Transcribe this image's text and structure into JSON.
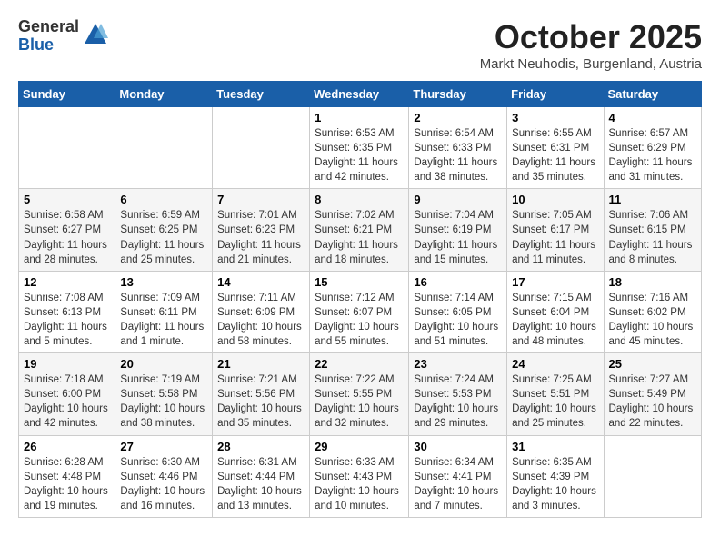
{
  "header": {
    "logo": {
      "general": "General",
      "blue": "Blue"
    },
    "title": "October 2025",
    "location": "Markt Neuhodis, Burgenland, Austria"
  },
  "weekdays": [
    "Sunday",
    "Monday",
    "Tuesday",
    "Wednesday",
    "Thursday",
    "Friday",
    "Saturday"
  ],
  "weeks": [
    [
      {
        "day": "",
        "info": ""
      },
      {
        "day": "",
        "info": ""
      },
      {
        "day": "",
        "info": ""
      },
      {
        "day": "1",
        "info": "Sunrise: 6:53 AM\nSunset: 6:35 PM\nDaylight: 11 hours\nand 42 minutes."
      },
      {
        "day": "2",
        "info": "Sunrise: 6:54 AM\nSunset: 6:33 PM\nDaylight: 11 hours\nand 38 minutes."
      },
      {
        "day": "3",
        "info": "Sunrise: 6:55 AM\nSunset: 6:31 PM\nDaylight: 11 hours\nand 35 minutes."
      },
      {
        "day": "4",
        "info": "Sunrise: 6:57 AM\nSunset: 6:29 PM\nDaylight: 11 hours\nand 31 minutes."
      }
    ],
    [
      {
        "day": "5",
        "info": "Sunrise: 6:58 AM\nSunset: 6:27 PM\nDaylight: 11 hours\nand 28 minutes."
      },
      {
        "day": "6",
        "info": "Sunrise: 6:59 AM\nSunset: 6:25 PM\nDaylight: 11 hours\nand 25 minutes."
      },
      {
        "day": "7",
        "info": "Sunrise: 7:01 AM\nSunset: 6:23 PM\nDaylight: 11 hours\nand 21 minutes."
      },
      {
        "day": "8",
        "info": "Sunrise: 7:02 AM\nSunset: 6:21 PM\nDaylight: 11 hours\nand 18 minutes."
      },
      {
        "day": "9",
        "info": "Sunrise: 7:04 AM\nSunset: 6:19 PM\nDaylight: 11 hours\nand 15 minutes."
      },
      {
        "day": "10",
        "info": "Sunrise: 7:05 AM\nSunset: 6:17 PM\nDaylight: 11 hours\nand 11 minutes."
      },
      {
        "day": "11",
        "info": "Sunrise: 7:06 AM\nSunset: 6:15 PM\nDaylight: 11 hours\nand 8 minutes."
      }
    ],
    [
      {
        "day": "12",
        "info": "Sunrise: 7:08 AM\nSunset: 6:13 PM\nDaylight: 11 hours\nand 5 minutes."
      },
      {
        "day": "13",
        "info": "Sunrise: 7:09 AM\nSunset: 6:11 PM\nDaylight: 11 hours\nand 1 minute."
      },
      {
        "day": "14",
        "info": "Sunrise: 7:11 AM\nSunset: 6:09 PM\nDaylight: 10 hours\nand 58 minutes."
      },
      {
        "day": "15",
        "info": "Sunrise: 7:12 AM\nSunset: 6:07 PM\nDaylight: 10 hours\nand 55 minutes."
      },
      {
        "day": "16",
        "info": "Sunrise: 7:14 AM\nSunset: 6:05 PM\nDaylight: 10 hours\nand 51 minutes."
      },
      {
        "day": "17",
        "info": "Sunrise: 7:15 AM\nSunset: 6:04 PM\nDaylight: 10 hours\nand 48 minutes."
      },
      {
        "day": "18",
        "info": "Sunrise: 7:16 AM\nSunset: 6:02 PM\nDaylight: 10 hours\nand 45 minutes."
      }
    ],
    [
      {
        "day": "19",
        "info": "Sunrise: 7:18 AM\nSunset: 6:00 PM\nDaylight: 10 hours\nand 42 minutes."
      },
      {
        "day": "20",
        "info": "Sunrise: 7:19 AM\nSunset: 5:58 PM\nDaylight: 10 hours\nand 38 minutes."
      },
      {
        "day": "21",
        "info": "Sunrise: 7:21 AM\nSunset: 5:56 PM\nDaylight: 10 hours\nand 35 minutes."
      },
      {
        "day": "22",
        "info": "Sunrise: 7:22 AM\nSunset: 5:55 PM\nDaylight: 10 hours\nand 32 minutes."
      },
      {
        "day": "23",
        "info": "Sunrise: 7:24 AM\nSunset: 5:53 PM\nDaylight: 10 hours\nand 29 minutes."
      },
      {
        "day": "24",
        "info": "Sunrise: 7:25 AM\nSunset: 5:51 PM\nDaylight: 10 hours\nand 25 minutes."
      },
      {
        "day": "25",
        "info": "Sunrise: 7:27 AM\nSunset: 5:49 PM\nDaylight: 10 hours\nand 22 minutes."
      }
    ],
    [
      {
        "day": "26",
        "info": "Sunrise: 6:28 AM\nSunset: 4:48 PM\nDaylight: 10 hours\nand 19 minutes."
      },
      {
        "day": "27",
        "info": "Sunrise: 6:30 AM\nSunset: 4:46 PM\nDaylight: 10 hours\nand 16 minutes."
      },
      {
        "day": "28",
        "info": "Sunrise: 6:31 AM\nSunset: 4:44 PM\nDaylight: 10 hours\nand 13 minutes."
      },
      {
        "day": "29",
        "info": "Sunrise: 6:33 AM\nSunset: 4:43 PM\nDaylight: 10 hours\nand 10 minutes."
      },
      {
        "day": "30",
        "info": "Sunrise: 6:34 AM\nSunset: 4:41 PM\nDaylight: 10 hours\nand 7 minutes."
      },
      {
        "day": "31",
        "info": "Sunrise: 6:35 AM\nSunset: 4:39 PM\nDaylight: 10 hours\nand 3 minutes."
      },
      {
        "day": "",
        "info": ""
      }
    ]
  ]
}
